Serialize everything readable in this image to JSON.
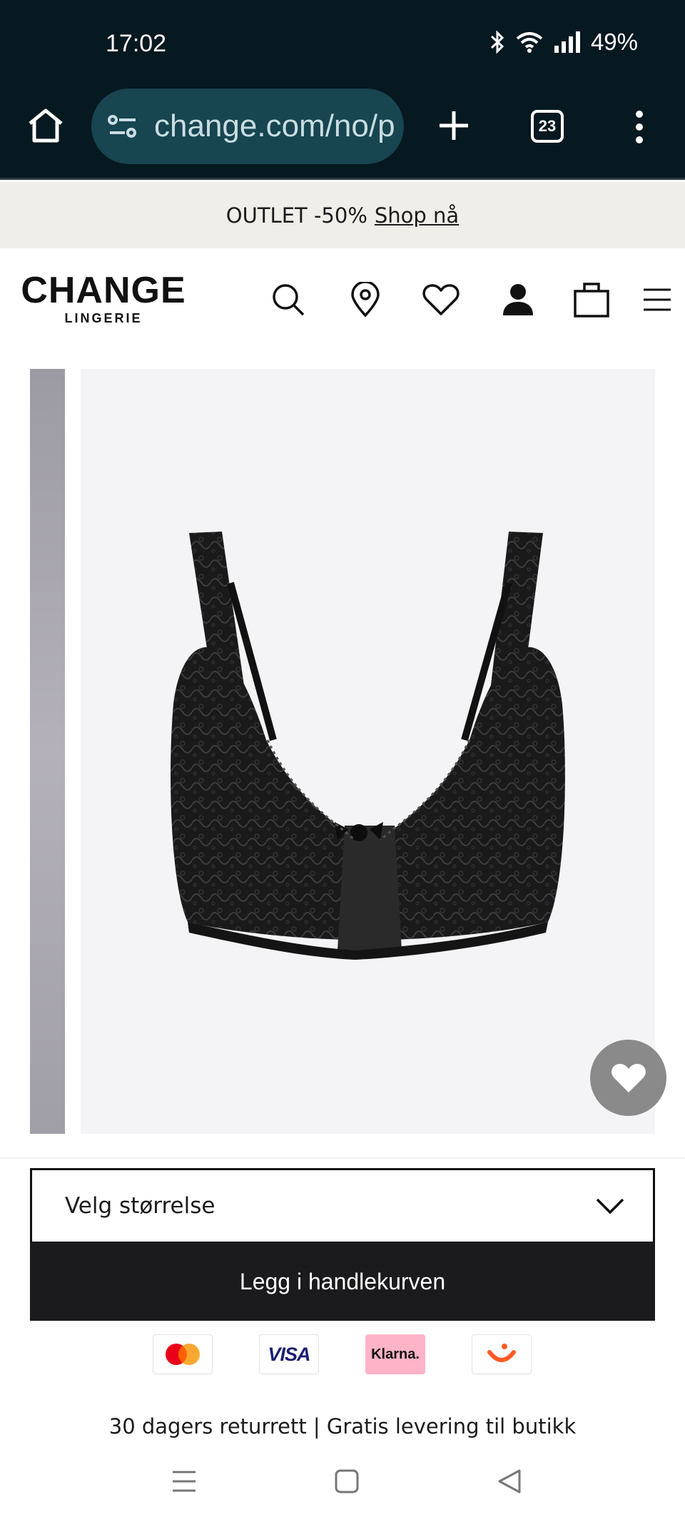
{
  "status_bar": {
    "time": "17:02",
    "battery": "49%",
    "icons": [
      "bluetooth-icon",
      "wifi-icon",
      "signal-icon"
    ]
  },
  "browser": {
    "url": "change.com/no/p",
    "tab_count": "23",
    "icons": [
      "home-icon",
      "site-settings-icon",
      "new-tab-icon",
      "tabs-icon",
      "more-menu-icon"
    ]
  },
  "promo": {
    "text": "OUTLET -50%",
    "link": "Shop nå"
  },
  "header": {
    "brand": "CHANGE",
    "brand_sub": "LINGERIE",
    "icons": [
      "search-icon",
      "store-locator-icon",
      "wishlist-icon",
      "account-icon",
      "bag-icon",
      "hamburger-menu-icon"
    ]
  },
  "product": {
    "image": "black-lace-bra-image",
    "favorite_icon": "heart-icon"
  },
  "purchase": {
    "size_select_label": "Velg størrelse",
    "add_to_cart_label": "Legg i handlekurven"
  },
  "payments": {
    "visa_label": "VISA",
    "klarna_label": "Klarna."
  },
  "info": {
    "text": "30 dagers returrett | Gratis levering til butikk"
  },
  "colors": {
    "status_bg": "#061820",
    "url_pill": "#174550",
    "promo_bg": "#f0eee8",
    "button_dark": "#1b1b1d",
    "klarna_pink": "#ffb3c7"
  }
}
